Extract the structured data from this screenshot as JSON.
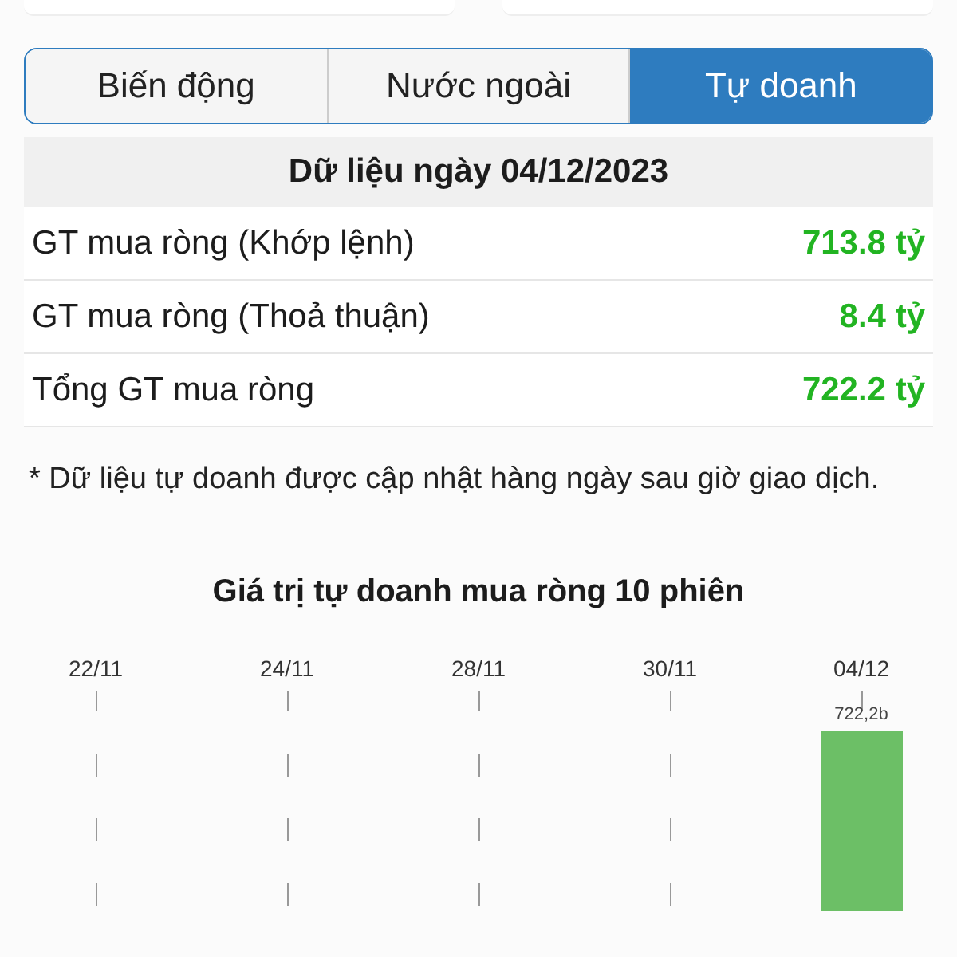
{
  "tabs": [
    {
      "label": "Biến động",
      "selected": false
    },
    {
      "label": "Nước ngoài",
      "selected": false
    },
    {
      "label": "Tự doanh",
      "selected": true
    }
  ],
  "table": {
    "title": "Dữ liệu ngày 04/12/2023",
    "rows": [
      {
        "label": "GT mua ròng (Khớp lệnh)",
        "value": "713.8 tỷ",
        "color": "#22b422"
      },
      {
        "label": "GT mua ròng (Thoả thuận)",
        "value": "8.4 tỷ",
        "color": "#22b422"
      },
      {
        "label": "Tổng GT mua ròng",
        "value": "722.2 tỷ",
        "color": "#22b422"
      }
    ]
  },
  "note": "* Dữ liệu tự doanh được cập nhật hàng ngày sau giờ giao dịch.",
  "chart": {
    "title": "Giá trị tự doanh mua ròng 10 phiên",
    "dates": [
      "22/11",
      "24/11",
      "28/11",
      "30/11",
      "04/12"
    ],
    "bar_label": "722,2b"
  }
}
